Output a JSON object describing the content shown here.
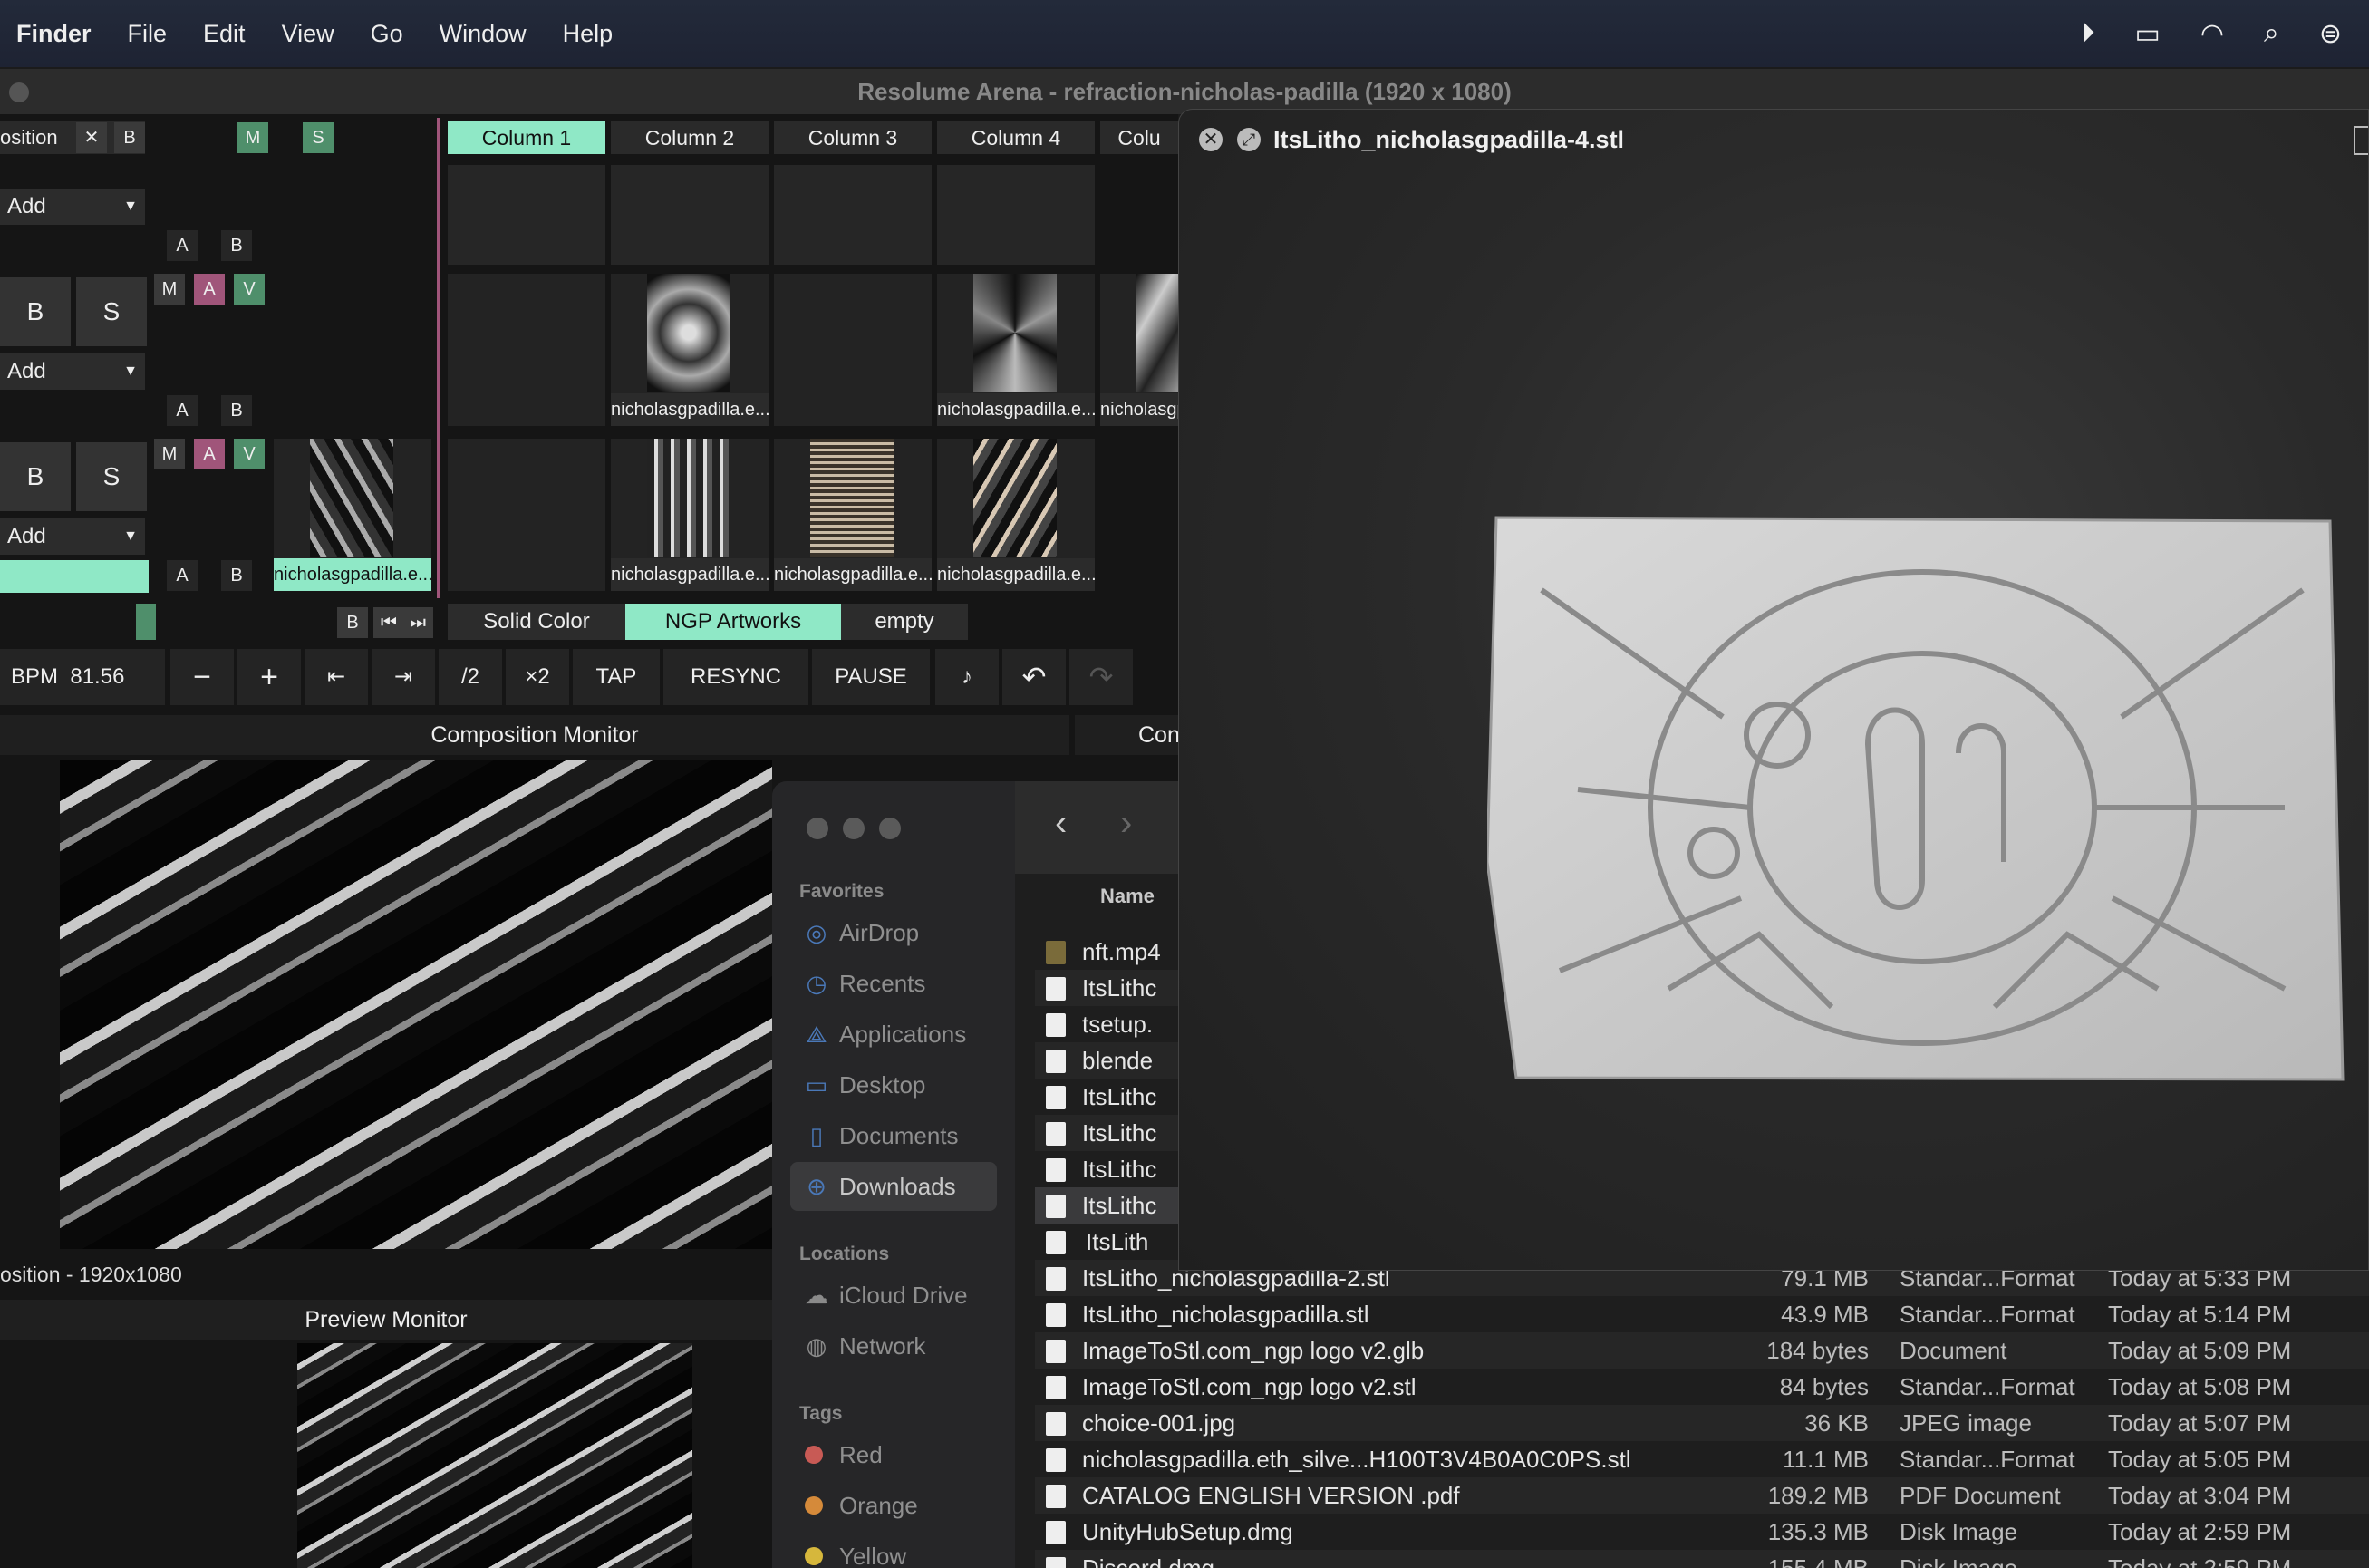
{
  "menubar": {
    "app": "Finder",
    "items": [
      "File",
      "Edit",
      "View",
      "Go",
      "Window",
      "Help"
    ]
  },
  "resolume": {
    "window_title": "Resolume Arena - refraction-nicholas-padilla (1920 x 1080)",
    "layer_label": "osition",
    "header_buttons": {
      "x": "✕",
      "b": "B",
      "m": "M",
      "s": "S"
    },
    "columns": [
      "Column 1",
      "Column 2",
      "Column 3",
      "Column 4",
      "Colu"
    ],
    "add_label": "Add",
    "a_label": "A",
    "b_label": "B",
    "m_label": "M",
    "v_label": "V",
    "big_b": "B",
    "big_s": "S",
    "clip_label": "nicholasgpadilla.e...",
    "clip_label_cut": "nicholasgp",
    "deck_tabs": [
      "Solid Color",
      "NGP Artworks",
      "empty"
    ],
    "deck_b": "B",
    "bpm_label": "BPM",
    "bpm_value": "81.56",
    "toolbar": {
      "minus": "−",
      "plus": "+",
      "half": "/2",
      "double": "×2",
      "tap": "TAP",
      "resync": "RESYNC",
      "pause": "PAUSE"
    },
    "composition_monitor": "Composition Monitor",
    "composition_monitor_cut": "Con",
    "composition_info": "osition - 1920x1080",
    "preview_monitor": "Preview Monitor"
  },
  "quicklook": {
    "title": "ItsLitho_nicholasgpadilla-4.stl"
  },
  "finder": {
    "sidebar": {
      "favorites_header": "Favorites",
      "favorites": [
        "AirDrop",
        "Recents",
        "Applications",
        "Desktop",
        "Documents",
        "Downloads"
      ],
      "locations_header": "Locations",
      "locations": [
        "iCloud Drive",
        "Network"
      ],
      "tags_header": "Tags",
      "tags": [
        "Red",
        "Orange",
        "Yellow"
      ]
    },
    "column_name": "Name",
    "rows_partial": [
      "nft.mp4",
      "ItsLithc",
      "tsetup.",
      "blende",
      "ItsLithc",
      "ItsLithc",
      "ItsLithc",
      "ItsLithc",
      "ItsLith"
    ],
    "rows": [
      {
        "name": "ItsLitho_nicholasgpadilla-2.stl",
        "size": "79.1 MB",
        "kind": "Standar...Format",
        "date": "Today at 5:33 PM"
      },
      {
        "name": "ItsLitho_nicholasgpadilla.stl",
        "size": "43.9 MB",
        "kind": "Standar...Format",
        "date": "Today at 5:14 PM"
      },
      {
        "name": "ImageToStl.com_ngp logo v2.glb",
        "size": "184 bytes",
        "kind": "Document",
        "date": "Today at 5:09 PM"
      },
      {
        "name": "ImageToStl.com_ngp logo v2.stl",
        "size": "84 bytes",
        "kind": "Standar...Format",
        "date": "Today at 5:08 PM"
      },
      {
        "name": "choice-001.jpg",
        "size": "36 KB",
        "kind": "JPEG image",
        "date": "Today at 5:07 PM"
      },
      {
        "name": "nicholasgpadilla.eth_silve...H100T3V4B0A0C0PS.stl",
        "size": "11.1 MB",
        "kind": "Standar...Format",
        "date": "Today at 5:05 PM"
      },
      {
        "name": "CATALOG ENGLISH VERSION .pdf",
        "size": "189.2 MB",
        "kind": "PDF Document",
        "date": "Today at 3:04 PM"
      },
      {
        "name": "UnityHubSetup.dmg",
        "size": "135.3 MB",
        "kind": "Disk Image",
        "date": "Today at 2:59 PM"
      },
      {
        "name": "Discord.dmg",
        "size": "155.4 MB",
        "kind": "Disk Image",
        "date": "Today at 2:59 PM"
      }
    ]
  },
  "colors": {
    "accent": "#8fe8c6",
    "pink": "#a0557a",
    "green": "#4f8f6b"
  }
}
